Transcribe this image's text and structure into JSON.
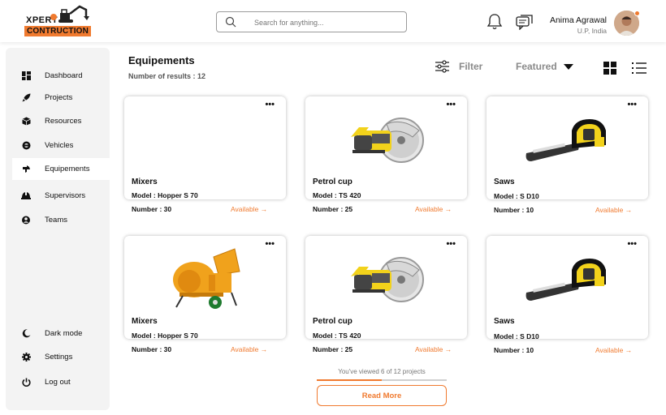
{
  "header": {
    "logo_top": "XPERT",
    "logo_bottom": "CONTRUCTION",
    "search_placeholder": "Search for anything...",
    "user_name": "Anima Agrawal",
    "user_location": "U.P, India"
  },
  "sidebar": {
    "items": [
      {
        "label": "Dashboard",
        "icon": "grid-icon"
      },
      {
        "label": "Projects",
        "icon": "rocket-icon"
      },
      {
        "label": "Resources",
        "icon": "box-icon"
      },
      {
        "label": "Vehicles",
        "icon": "vehicle-icon"
      },
      {
        "label": "Equipements",
        "icon": "equipment-icon",
        "active": true
      },
      {
        "label": "Supervisors",
        "icon": "helmet-icon"
      },
      {
        "label": "Teams",
        "icon": "team-icon"
      }
    ],
    "bottom_items": [
      {
        "label": "Dark mode",
        "icon": "moon-icon"
      },
      {
        "label": "Settings",
        "icon": "gear-icon"
      },
      {
        "label": "Log out",
        "icon": "power-icon"
      }
    ]
  },
  "main": {
    "title": "Equipements",
    "results_label": "Number of results : 12",
    "filter_label": "Filter",
    "sort_label": "Featured"
  },
  "cards": [
    {
      "name": "Mixers",
      "model": "Model : Hopper S 70",
      "number": "Number :  30",
      "status": "Available →",
      "image": "none"
    },
    {
      "name": "Petrol cup",
      "model": "Model : TS 420",
      "number": "Number :  25",
      "status": "Available →",
      "image": "cut-saw"
    },
    {
      "name": "Saws",
      "model": "Model : S D10",
      "number": "Number :  10",
      "status": "Available →",
      "image": "chainsaw"
    },
    {
      "name": "Mixers",
      "model": "Model : Hopper S 70",
      "number": "Number :  30",
      "status": "Available →",
      "image": "mixer"
    },
    {
      "name": "Petrol cup",
      "model": "Model : TS 420",
      "number": "Number :  25",
      "status": "Available →",
      "image": "cut-saw"
    },
    {
      "name": "Saws",
      "model": "Model : S D10",
      "number": "Number :  10",
      "status": "Available →",
      "image": "chainsaw"
    }
  ],
  "pagination": {
    "viewed_text": "You've viewed 6 of 12 projects",
    "progress_fraction": 0.5,
    "read_more_label": "Read More"
  },
  "colors": {
    "accent": "#f07a2f",
    "sidebar_bg": "#f3f3f3"
  }
}
